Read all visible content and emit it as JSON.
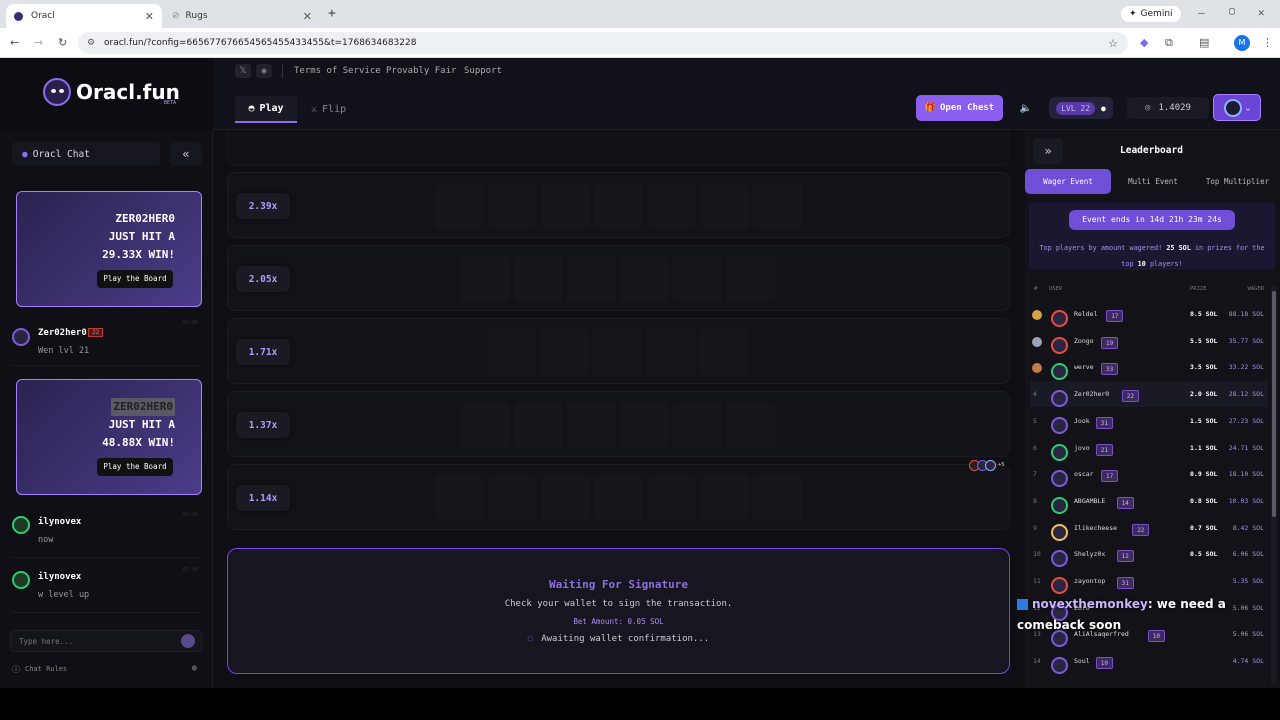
{
  "browser": {
    "tabs": [
      {
        "title": "Oracl"
      },
      {
        "title": "Rugs"
      }
    ],
    "url": "oracl.fun/?config=665677676654565455433455&t=1768634683228",
    "profile_initial": "M",
    "gemini_label": "Gemini"
  },
  "header": {
    "brand": "Oracl.fun",
    "beta": "BETA",
    "links": [
      "Terms of Service",
      "Provably Fair",
      "Support"
    ],
    "tabs": {
      "play": "Play",
      "flip": "Flip"
    },
    "open_chest": "Open Chest",
    "level": "LVL 22",
    "balance": "1.4029"
  },
  "chat": {
    "title": "Oracl Chat",
    "input_placeholder": "Type here...",
    "rules": "Chat Rules",
    "win_cards": [
      {
        "user": "ZER02HER0",
        "line2": "JUST HIT A",
        "line3": "29.33X WIN!",
        "button": "Play the Board"
      },
      {
        "user": "ZER02HER0",
        "line2": "JUST HIT A",
        "line3": "48.88X WIN!",
        "button": "Play the Board"
      }
    ],
    "messages": [
      {
        "user": "Zer02her0",
        "level": "22",
        "text": "Wen lvl 21",
        "time": "02:00"
      },
      {
        "user": "ilynovex",
        "text": "now",
        "time": "01:10"
      },
      {
        "user": "ilynovex",
        "text": "w level up",
        "time": "01:10"
      }
    ]
  },
  "board": {
    "multipliers": [
      "2.39x",
      "2.05x",
      "1.71x",
      "1.37x",
      "1.14x"
    ],
    "tiles_per_row": [
      7,
      6,
      5,
      6,
      7
    ],
    "extra_players": "+5"
  },
  "signature": {
    "title": "Waiting For Signature",
    "subtitle": "Check your wallet to sign the transaction.",
    "bet_label": "Bet Amount: 0.05 SOL",
    "status": "Awaiting wallet confirmation..."
  },
  "leaderboard": {
    "title": "Leaderboard",
    "tabs": [
      "Wager Event",
      "Multi Event",
      "Top Multiplier"
    ],
    "event_ends": "Event ends in 14d 21h 23m 24s",
    "desc_pre": "Top players by amount wagered!",
    "desc_prize": "25 SOL",
    "desc_mid": "in prizes for the top",
    "desc_top": "10",
    "desc_post": "players!",
    "columns": {
      "rank": "#",
      "user": "USER",
      "prize": "PRIZE",
      "wager": "WAGER"
    },
    "rows": [
      {
        "rank": "1",
        "user": "Reldel",
        "level": "17",
        "prize": "8.5 SOL",
        "wager": "88.18 SOL",
        "color": "#e74c3c"
      },
      {
        "rank": "2",
        "user": "Zongo",
        "level": "19",
        "prize": "5.5 SOL",
        "wager": "35.77 SOL",
        "color": "#e74c3c"
      },
      {
        "rank": "3",
        "user": "werve",
        "level": "33",
        "prize": "3.5 SOL",
        "wager": "33.22 SOL",
        "color": "#2ecc71"
      },
      {
        "rank": "4",
        "user": "Zer02her0",
        "level": "22",
        "prize": "2.0 SOL",
        "wager": "28.12 SOL",
        "color": "#7c5bd6"
      },
      {
        "rank": "5",
        "user": "Jook",
        "level": "31",
        "prize": "1.5 SOL",
        "wager": "27.23 SOL",
        "color": "#7c5bd6"
      },
      {
        "rank": "6",
        "user": "jovo",
        "level": "21",
        "prize": "1.1 SOL",
        "wager": "24.71 SOL",
        "color": "#2ecc71"
      },
      {
        "rank": "7",
        "user": "oscar",
        "level": "17",
        "prize": "0.9 SOL",
        "wager": "18.10 SOL",
        "color": "#7c5bd6"
      },
      {
        "rank": "8",
        "user": "ABGAMBLE",
        "level": "14",
        "prize": "0.8 SOL",
        "wager": "10.03 SOL",
        "color": "#2ecc71"
      },
      {
        "rank": "9",
        "user": "Ilikecheese",
        "level": "22",
        "prize": "0.7 SOL",
        "wager": "8.42 SOL",
        "color": "#f0c060"
      },
      {
        "rank": "10",
        "user": "Shelyz0x",
        "level": "12",
        "prize": "0.5 SOL",
        "wager": "6.06 SOL",
        "color": "#7c5bd6"
      },
      {
        "rank": "11",
        "user": "zayontop",
        "level": "31",
        "prize": "",
        "wager": "5.35 SOL",
        "color": "#e74c3c"
      },
      {
        "rank": "12",
        "user": "Zoro",
        "level": "",
        "prize": "",
        "wager": "5.06 SOL",
        "color": "#7c5bd6"
      },
      {
        "rank": "13",
        "user": "AliAlsaqerfred",
        "level": "10",
        "prize": "",
        "wager": "5.06 SOL",
        "color": "#7c5bd6"
      },
      {
        "rank": "14",
        "user": "Soul",
        "level": "10",
        "prize": "",
        "wager": "4.74 SOL",
        "color": "#7c5bd6"
      }
    ]
  },
  "overlay": {
    "user": "novexthemonkey",
    "message": ": we need a comeback soon"
  }
}
